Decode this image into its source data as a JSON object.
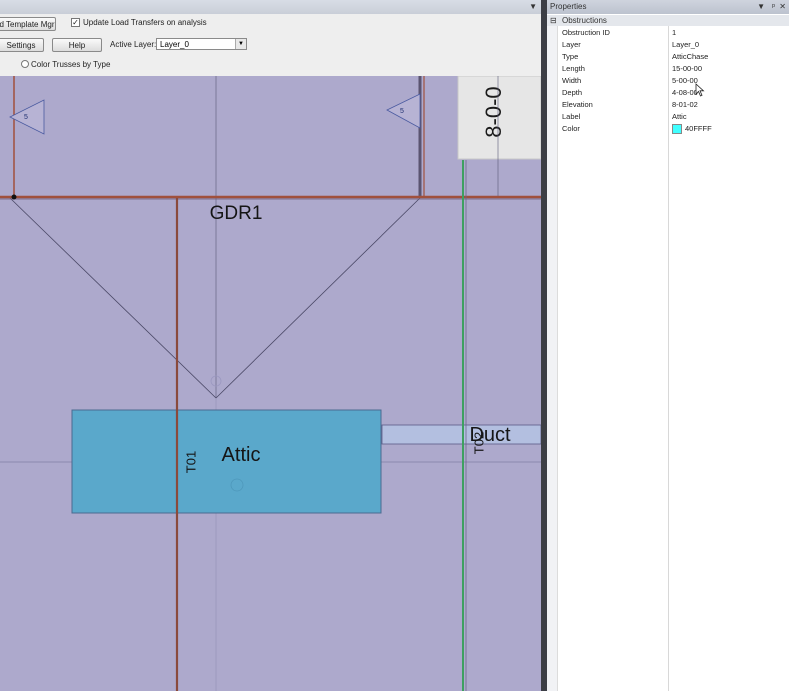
{
  "toolbar": {
    "load_template_label": "d Template Mgr",
    "update_load_transfers_label": "Update Load Transfers on analysis",
    "update_load_transfers_checked": true,
    "settings_label": "Settings",
    "help_label": "Help",
    "active_layer_label": "Active Layer:",
    "active_layer_value": "Layer_0",
    "color_trusses_label": "Color Trusses by Type"
  },
  "canvas": {
    "background": "#ada9cc",
    "tag_left": "5",
    "tag_right": "5",
    "dimension_label": "8-0-0",
    "girder_label": "GDR1",
    "attic_label": "Attic",
    "duct_label": "Duct",
    "truss_t01": "T01",
    "truss_t02": "T02",
    "attic_fill": "#5aa8cb"
  },
  "properties": {
    "title": "Properties",
    "category": "Obstructions",
    "collapse_symbol": "⊟",
    "rows": [
      {
        "key": "Obstruction ID",
        "value": "1"
      },
      {
        "key": "Layer",
        "value": "Layer_0"
      },
      {
        "key": "Type",
        "value": "AtticChase"
      },
      {
        "key": "Length",
        "value": "15-00-00"
      },
      {
        "key": "Width",
        "value": "5-00-00"
      },
      {
        "key": "Depth",
        "value": "4-08-00"
      },
      {
        "key": "Elevation",
        "value": "8-01-02"
      },
      {
        "key": "Label",
        "value": "Attic"
      },
      {
        "key": "Color",
        "value": "40FFFF"
      }
    ],
    "color_swatch": "#40ffff"
  }
}
